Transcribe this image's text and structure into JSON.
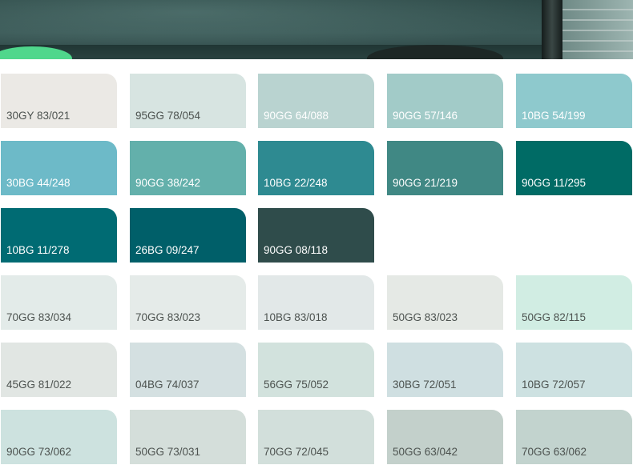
{
  "hero": {
    "description_icon": "room-scene-image"
  },
  "swatch_rows": [
    [
      {
        "code": "30GY 83/021",
        "color": "#ebe9e5",
        "text": "light"
      },
      {
        "code": "95GG 78/054",
        "color": "#d7e4e1",
        "text": "light"
      },
      {
        "code": "90GG 64/088",
        "color": "#b9d3d0",
        "text": "dark"
      },
      {
        "code": "90GG 57/146",
        "color": "#a2cbc8",
        "text": "dark"
      },
      {
        "code": "10BG 54/199",
        "color": "#8ec9cd",
        "text": "dark"
      }
    ],
    [
      {
        "code": "30BG 44/248",
        "color": "#6dbac8",
        "text": "dark"
      },
      {
        "code": "90GG 38/242",
        "color": "#63b0ab",
        "text": "dark"
      },
      {
        "code": "10BG 22/248",
        "color": "#2e8a91",
        "text": "dark"
      },
      {
        "code": "90GG 21/219",
        "color": "#408884",
        "text": "dark"
      },
      {
        "code": "90GG 11/295",
        "color": "#006b65",
        "text": "dark"
      }
    ],
    [
      {
        "code": "10BG 11/278",
        "color": "#006b73",
        "text": "dark"
      },
      {
        "code": "26BG 09/247",
        "color": "#005f69",
        "text": "dark"
      },
      {
        "code": "90GG 08/118",
        "color": "#2f4c4b",
        "text": "dark"
      }
    ],
    [
      {
        "code": "70GG 83/034",
        "color": "#e3ebe9",
        "text": "light"
      },
      {
        "code": "70GG 83/023",
        "color": "#e5ebe9",
        "text": "light"
      },
      {
        "code": "10BG 83/018",
        "color": "#e2e8e8",
        "text": "light"
      },
      {
        "code": "50GG 83/023",
        "color": "#e5e9e5",
        "text": "light"
      },
      {
        "code": "50GG 82/115",
        "color": "#d1ede3",
        "text": "light"
      }
    ],
    [
      {
        "code": "45GG 81/022",
        "color": "#e1e6e3",
        "text": "light"
      },
      {
        "code": "04BG 74/037",
        "color": "#d4e0e1",
        "text": "light"
      },
      {
        "code": "56GG 75/052",
        "color": "#d2e2dd",
        "text": "light"
      },
      {
        "code": "30BG 72/051",
        "color": "#cfdfe1",
        "text": "light"
      },
      {
        "code": "10BG 72/057",
        "color": "#cde1e1",
        "text": "light"
      }
    ],
    [
      {
        "code": "90GG 73/062",
        "color": "#cde2df",
        "text": "light"
      },
      {
        "code": "50GG 73/031",
        "color": "#d4deda",
        "text": "light"
      },
      {
        "code": "70GG 72/045",
        "color": "#d2dfdb",
        "text": "light"
      },
      {
        "code": "50GG 63/042",
        "color": "#c3d0cb",
        "text": "light"
      },
      {
        "code": "70GG 63/062",
        "color": "#c2d3ce",
        "text": "light"
      }
    ]
  ]
}
